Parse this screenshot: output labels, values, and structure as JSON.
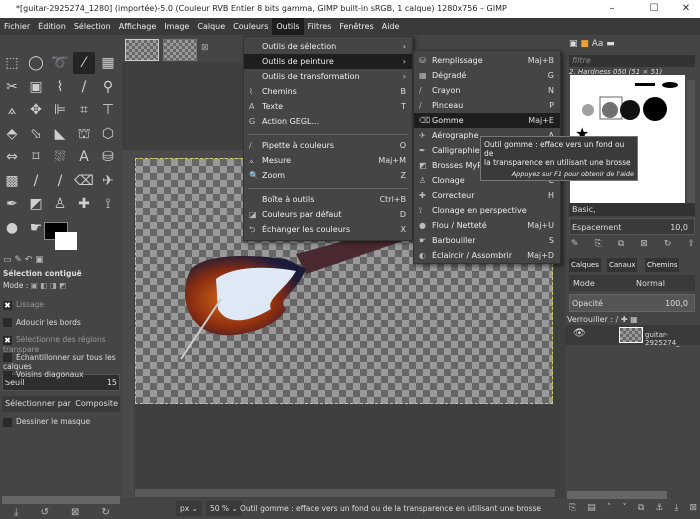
{
  "window": {
    "title": "*[guitar-2925274_1280] (importée)-5.0 (Couleur RVB Entier 8 bits gamma, GIMP built-in sRGB, 1 calque) 1280x756 – GIMP",
    "minimize": "–",
    "maximize": "☐",
    "close": "✕"
  },
  "menubar": [
    "Fichier",
    "Édition",
    "Sélection",
    "Affichage",
    "Image",
    "Calque",
    "Couleurs",
    "Outils",
    "Filtres",
    "Fenêtres",
    "Aide"
  ],
  "menu_outils": [
    {
      "label": "Outils de sélection",
      "shortcut": "›",
      "icon": ""
    },
    {
      "label": "Outils de peinture",
      "shortcut": "›",
      "icon": "",
      "highlighted": true
    },
    {
      "label": "Outils de transformation",
      "shortcut": "›",
      "icon": ""
    },
    {
      "label": "Chemins",
      "shortcut": "B",
      "icon": "⌇"
    },
    {
      "label": "Texte",
      "shortcut": "T",
      "icon": "A"
    },
    {
      "label": "Action GEGL...",
      "shortcut": "",
      "icon": "G"
    },
    {
      "label": "Pipette à couleurs",
      "shortcut": "O",
      "icon": "/"
    },
    {
      "label": "Mesure",
      "shortcut": "Maj+M",
      "icon": "⟑"
    },
    {
      "label": "Zoom",
      "shortcut": "Z",
      "icon": "🔍"
    },
    {
      "label": "Boîte à outils",
      "shortcut": "Ctrl+B",
      "icon": ""
    },
    {
      "label": "Couleurs par défaut",
      "shortcut": "D",
      "icon": "◪"
    },
    {
      "label": "Échanger les couleurs",
      "shortcut": "X",
      "icon": "⮌"
    }
  ],
  "submenu_peinture": [
    {
      "label": "Remplissage",
      "shortcut": "Maj+B",
      "icon": "⛁"
    },
    {
      "label": "Dégradé",
      "shortcut": "G",
      "icon": "▦"
    },
    {
      "label": "Crayon",
      "shortcut": "N",
      "icon": "/"
    },
    {
      "label": "Pinceau",
      "shortcut": "P",
      "icon": "/"
    },
    {
      "label": "Gomme",
      "shortcut": "Maj+E",
      "icon": "⌫",
      "highlighted": true
    },
    {
      "label": "Aérographe",
      "shortcut": "A",
      "icon": "✈"
    },
    {
      "label": "Calligraphie",
      "shortcut": "K",
      "icon": "✒"
    },
    {
      "label": "Brosses MyPaint",
      "shortcut": "Y",
      "icon": "◩"
    },
    {
      "label": "Clonage",
      "shortcut": "C",
      "icon": "♙"
    },
    {
      "label": "Correcteur",
      "shortcut": "H",
      "icon": "✚"
    },
    {
      "label": "Clonage en perspective",
      "shortcut": "",
      "icon": "⟟"
    },
    {
      "label": "Flou / Netteté",
      "shortcut": "Maj+U",
      "icon": "●"
    },
    {
      "label": "Barbouiller",
      "shortcut": "S",
      "icon": "☛"
    },
    {
      "label": "Éclaircir / Assombrir",
      "shortcut": "Maj+D",
      "icon": "◐"
    }
  ],
  "tooltip": {
    "line1": "Outil gomme : efface vers un fond ou de",
    "line2": "la transparence en utilisant une brosse",
    "hint": "Appuyez sur F1 pour obtenir de l'aide"
  },
  "tool_options": {
    "title": "Sélection contiguë",
    "mode_label": "Mode :",
    "options": [
      {
        "label": "Lissage",
        "checked": true,
        "dim": true
      },
      {
        "label": "Adoucir les bords",
        "checked": false
      },
      {
        "label": "Sélectionne des régions transpare",
        "checked": true,
        "dim": true
      },
      {
        "label": "Échantillonner sur tous les calques",
        "checked": false
      },
      {
        "label": "Voisins diagonaux",
        "checked": false
      }
    ],
    "threshold_label": "Seuil",
    "threshold_value": "15",
    "select_by_label": "Sélectionner par",
    "select_by_value": "Composite",
    "draw_mask_label": "Dessiner le masque"
  },
  "statusbar": {
    "unit": "px",
    "zoom": "50 %",
    "message": "Outil gomme : efface vers un fond ou de la transparence en utilisant une brosse"
  },
  "brushes": {
    "filter_placeholder": "filtre",
    "brush_name": "2. Hardness 050 (51 × 51)",
    "preset": "Basic,",
    "spacing_label": "Espacement",
    "spacing_value": "10,0"
  },
  "layers": {
    "tabs": [
      "Calques",
      "Canaux",
      "Chemins"
    ],
    "mode_label": "Mode",
    "mode_value": "Normal",
    "opacity_label": "Opacité",
    "opacity_value": "100,0",
    "lock_label": "Verrouiller :",
    "layer_name": "guitar-2925274_"
  }
}
